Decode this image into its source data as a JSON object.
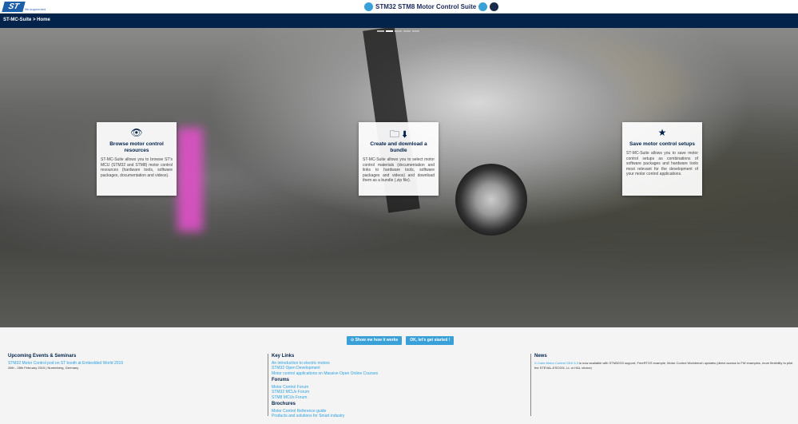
{
  "header": {
    "logo": "ST",
    "logo_tagline": "life.augmented",
    "title": "STM32 STM8 Motor Control Suite"
  },
  "breadcrumb": {
    "root": "ST-MC-Suite",
    "current": "> Home"
  },
  "cards": [
    {
      "icon": "eye-icon",
      "title": "Browse motor control resources",
      "text": "ST-MC-Suite allows you to browse ST's MCU (STM32 and STM8) motor control resources (hardware tools, software packages, documentation and videos)."
    },
    {
      "icon": "folder-download-icon",
      "title": "Create and download a bundle",
      "text": "ST-MC-Suite allows you to select motor control materials (documentation and links to hardware tools, software packages and videos) and download them as a bundle (.zip file)."
    },
    {
      "icon": "toolbox-star-icon",
      "title": "Save motor control setups",
      "text": "ST-MC-Suite allows you to save motor control setups as combinations of software packages and hardware tools most relevant for the development of your motor control applications."
    }
  ],
  "buttons": {
    "show": "Show me how it works",
    "start": "OK, let's get started !"
  },
  "events": {
    "title": "Upcoming Events & Seminars",
    "link": "STM32 Motor Control pod on ST booth at Embedded World 2019",
    "detail": "26th - 28th February 2019 | Nuremberg, Germany"
  },
  "key_links": {
    "title": "Key Links",
    "links": [
      "An introduction to electric motors",
      "STM32 Open Development",
      "Motor control applications on Massive Open Online Courses"
    ]
  },
  "forums": {
    "title": "Forums",
    "links": [
      "Motor Control Forum",
      "STM32 MCUs Forum",
      "STM8 MCUs Forum"
    ]
  },
  "brochures": {
    "title": "Brochures",
    "links": [
      "Motor Control Reference guide",
      "Products and solutions for Smart industry"
    ]
  },
  "news": {
    "title": "News",
    "link": "X-Cube Motor Control SDK 5.3",
    "text": " is now available with STM32G0 support, FreeRTOS example, Motor Control Workbench updates (direct access to FW examples, more flexibility to pilot the STEVAL-ESC001, LL or HAL choice)"
  }
}
